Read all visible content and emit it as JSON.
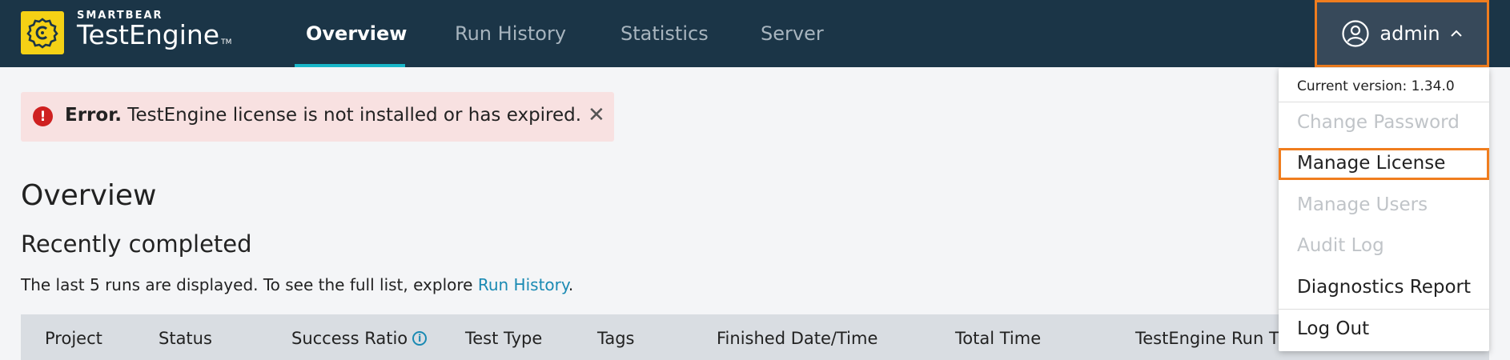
{
  "brand": {
    "company": "SMARTBEAR",
    "product": "TestEngine",
    "trademark": "TM",
    "logo_color": "#f5d115"
  },
  "nav": {
    "tabs": [
      {
        "label": "Overview",
        "active": true
      },
      {
        "label": "Run History",
        "active": false
      },
      {
        "label": "Statistics",
        "active": false
      },
      {
        "label": "Server",
        "active": false
      }
    ],
    "accent": "#19b7c9",
    "bar_color": "#1b3547"
  },
  "user": {
    "name": "admin",
    "avatar_icon": "user-circle-icon",
    "chevron_icon": "chevron-up-icon"
  },
  "error": {
    "icon": "exclamation-circle-icon",
    "title": "Error.",
    "message": " TestEngine license is not installed or has expired.",
    "close": "✕"
  },
  "page": {
    "title": "Overview",
    "section_title": "Recently completed",
    "description_prefix": "The last 5 runs are displayed. To see the full list, explore ",
    "description_link": "Run History",
    "description_suffix": "."
  },
  "table": {
    "columns": [
      "Project",
      "Status",
      "Success Ratio",
      "Test Type",
      "Tags",
      "Finished Date/Time",
      "Total Time",
      "TestEngine Run Tim"
    ],
    "info_icon": "info-circle-icon"
  },
  "dropdown": {
    "version": "Current version: 1.34.0",
    "items": [
      {
        "label": "Change Password",
        "enabled": false
      },
      {
        "label": "Manage License",
        "enabled": true
      },
      {
        "label": "Manage Users",
        "enabled": false
      },
      {
        "label": "Audit Log",
        "enabled": false
      },
      {
        "label": "Diagnostics Report",
        "enabled": true
      },
      {
        "label": "Log Out",
        "enabled": true
      }
    ],
    "highlight_color": "#f07d1e"
  }
}
